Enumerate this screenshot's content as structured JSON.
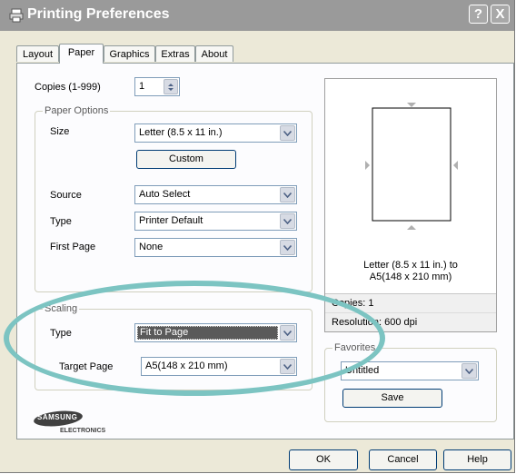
{
  "window": {
    "title": "Printing Preferences",
    "help_button": "?",
    "close_button": "X"
  },
  "tabs": [
    {
      "label": "Layout",
      "active": false
    },
    {
      "label": "Paper",
      "active": true
    },
    {
      "label": "Graphics",
      "active": false
    },
    {
      "label": "Extras",
      "active": false
    },
    {
      "label": "About",
      "active": false
    }
  ],
  "copies": {
    "label": "Copies (1-999)",
    "value": "1"
  },
  "paper_options": {
    "title": "Paper Options",
    "size_label": "Size",
    "size_value": "Letter (8.5 x 11 in.)",
    "custom_button": "Custom",
    "source_label": "Source",
    "source_value": "Auto Select",
    "type_label": "Type",
    "type_value": "Printer Default",
    "first_page_label": "First Page",
    "first_page_value": "None"
  },
  "scaling": {
    "title": "Scaling",
    "type_label": "Type",
    "type_value": "Fit to Page",
    "target_label": "Target Page",
    "target_value": "A5(148 x 210 mm)"
  },
  "preview": {
    "caption_line1": "Letter (8.5 x 11 in.) to",
    "caption_line2": "A5(148 x 210 mm)",
    "copies": "Copies: 1",
    "resolution": "Resolution: 600 dpi"
  },
  "favorites": {
    "title": "Favorites",
    "value": "Untitled",
    "save_button": "Save"
  },
  "logo": {
    "brand": "SAMSUNG",
    "sub": "ELECTRONICS"
  },
  "buttons": {
    "ok": "OK",
    "cancel": "Cancel",
    "help": "Help"
  },
  "colors": {
    "highlight_oval": "#7cc4c2",
    "selected_bg": "#5a5a5a"
  }
}
